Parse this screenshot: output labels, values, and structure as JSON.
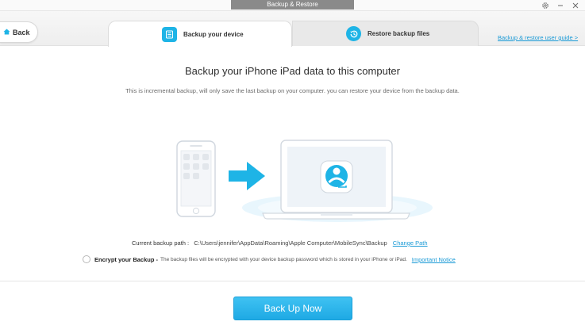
{
  "window": {
    "title": "Backup & Restore"
  },
  "nav": {
    "back_label": "Back"
  },
  "tabs": [
    {
      "label": "Backup your device",
      "active": true
    },
    {
      "label": "Restore backup files",
      "active": false
    }
  ],
  "guide_link": "Backup & restore user guide >",
  "main": {
    "heading": "Backup your iPhone iPad data to this computer",
    "subtext": "This is incremental backup, will only save the last backup on your computer. you can restore your device from the backup data.",
    "path_label": "Current backup path :",
    "path_value": "C:\\Users\\jennifer\\AppData\\Roaming\\Apple Computer\\MobileSync\\Backup",
    "change_path": "Change Path",
    "encrypt_label": "Encrypt your Backup -",
    "encrypt_desc": "The backup files will be encrypted with your device backup password which is stored in your iPhone or iPad.",
    "important_notice": "Important Notice",
    "encrypt_checked": false,
    "backup_button": "Back Up Now"
  },
  "colors": {
    "accent": "#1eb4e6",
    "link": "#1a9ad6",
    "button": "#2bb5ea"
  },
  "icons": {
    "back": "home-icon",
    "backup_tab": "document-icon",
    "restore_tab": "restore-clock-icon",
    "settings": "gear-icon",
    "arrow": "right-arrow-icon",
    "app": "app-logo-icon"
  }
}
